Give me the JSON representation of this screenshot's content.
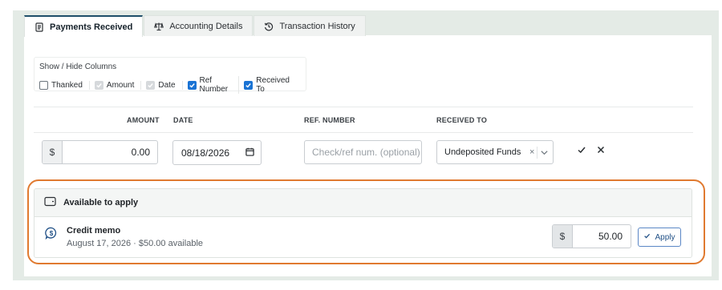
{
  "tabs": [
    {
      "label": "Payments Received",
      "icon": "receipt-icon",
      "active": true
    },
    {
      "label": "Accounting Details",
      "icon": "scale-icon",
      "active": false
    },
    {
      "label": "Transaction History",
      "icon": "history-icon",
      "active": false
    }
  ],
  "columns_panel": {
    "title": "Show / Hide Columns",
    "options": [
      {
        "label": "Thanked",
        "state": "unchecked"
      },
      {
        "label": "Amount",
        "state": "disabled-checked"
      },
      {
        "label": "Date",
        "state": "disabled-checked"
      },
      {
        "label": "Ref Number",
        "state": "checked"
      },
      {
        "label": "Received To",
        "state": "checked"
      }
    ]
  },
  "table": {
    "headers": {
      "amount": "AMOUNT",
      "date": "DATE",
      "ref": "REF. NUMBER",
      "received_to": "RECEIVED TO"
    },
    "row": {
      "currency": "$",
      "amount": "0.00",
      "date": "08/18/2026",
      "ref_placeholder": "Check/ref num.  (optional)",
      "received_to": "Undeposited Funds",
      "clear": "×"
    }
  },
  "available": {
    "title": "Available to apply",
    "item": {
      "title": "Credit memo",
      "subtitle": "August 17, 2026 · $50.00 available",
      "currency": "$",
      "amount": "50.00",
      "apply_label": "Apply"
    }
  },
  "colors": {
    "accent": "#1f4f6a",
    "checkbox": "#1a73d4",
    "highlight": "#e07a30",
    "frame": "#e4ebe6"
  }
}
